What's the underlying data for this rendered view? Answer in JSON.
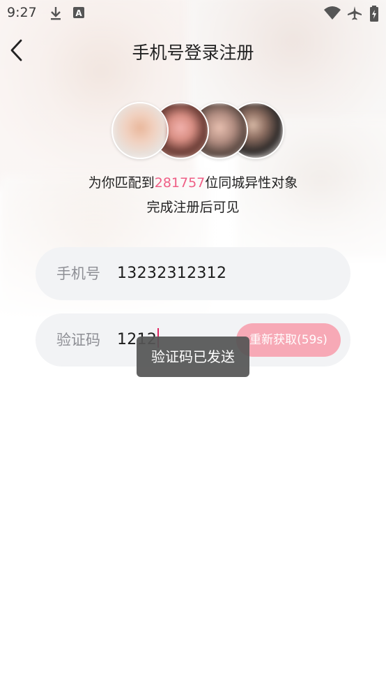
{
  "status_bar": {
    "time": "9:27",
    "icons": [
      "download-icon",
      "keyboard-a-icon",
      "wifi-icon",
      "airplane-icon",
      "battery-charging-icon"
    ]
  },
  "header": {
    "back_icon": "chevron-left-icon",
    "title": "手机号登录注册"
  },
  "promo": {
    "prefix": "为你匹配到",
    "count": "281757",
    "suffix": "位同城异性对象",
    "line2": "完成注册后可见",
    "count_color": "#ef5f86"
  },
  "avatars": [
    "avatar-1",
    "avatar-2",
    "avatar-3",
    "avatar-4"
  ],
  "form": {
    "phone": {
      "label": "手机号",
      "value": "13232312312"
    },
    "code": {
      "label": "验证码",
      "value": "1212",
      "resend_label": "重新获取(59s)"
    }
  },
  "toast": {
    "message": "验证码已发送"
  },
  "colors": {
    "accent": "#f7a9b6",
    "highlight": "#ef5f86",
    "field_bg": "#f2f3f5"
  }
}
